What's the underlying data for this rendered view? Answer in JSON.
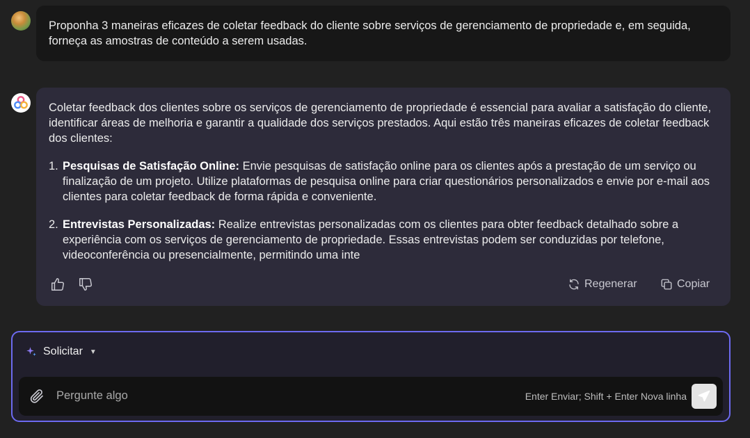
{
  "user_message": {
    "text": "Proponha 3 maneiras eficazes de coletar feedback do cliente sobre serviços de gerenciamento de propriedade e, em seguida, forneça as amostras de conteúdo a serem usadas."
  },
  "assistant_message": {
    "intro": "Coletar feedback dos clientes sobre os serviços de gerenciamento de propriedade é essencial para avaliar a satisfação do cliente, identificar áreas de melhoria e garantir a qualidade dos serviços prestados. Aqui estão três maneiras eficazes de coletar feedback dos clientes:",
    "items": [
      {
        "number": "1.",
        "title": "Pesquisas de Satisfação Online:",
        "text": " Envie pesquisas de satisfação online para os clientes após a prestação de um serviço ou finalização de um projeto. Utilize plataformas de pesquisa online para criar questionários personalizados e envie por e-mail aos clientes para coletar feedback de forma rápida e conveniente."
      },
      {
        "number": "2.",
        "title": "Entrevistas Personalizadas:",
        "text": " Realize entrevistas personalizadas com os clientes para obter feedback detalhado sobre a experiência com os serviços de gerenciamento de propriedade. Essas entrevistas podem ser conduzidas por telefone, videoconferência ou presencialmente, permitindo uma inte"
      }
    ],
    "actions": {
      "like_icon": "thumbs-up-icon",
      "dislike_icon": "thumbs-down-icon",
      "regenerate_label": "Regenerar",
      "copy_label": "Copiar"
    }
  },
  "composer": {
    "mode_label": "Solicitar",
    "placeholder": "Pergunte algo",
    "hint": "Enter Enviar; Shift + Enter Nova linha",
    "accent_color": "#6d6af0"
  }
}
